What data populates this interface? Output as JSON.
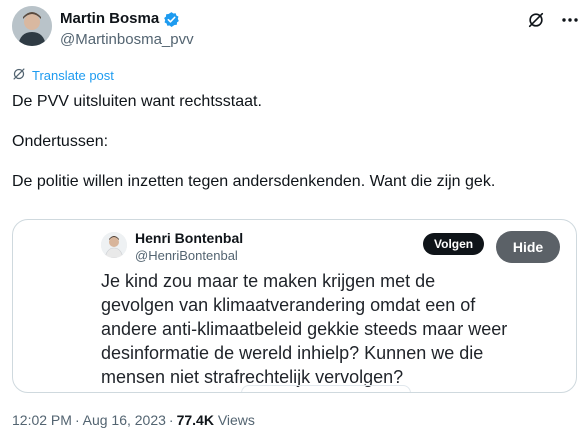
{
  "author": {
    "name": "Martin Bosma",
    "handle": "@Martinbosma_pvv"
  },
  "translate": {
    "label": "Translate post"
  },
  "post": {
    "lines": [
      "De PVV uitsluiten want rechtsstaat.",
      "Ondertussen:",
      "De politie willen inzetten tegen andersdenkenden. Want die zijn gek."
    ]
  },
  "quote": {
    "name": "Henri Bontenbal",
    "handle": "@HenriBontenbal",
    "follow_label": "Volgen",
    "text": "Je kind zou maar te maken krijgen met de gevolgen van klimaatverandering omdat een of andere anti-klimaatbeleid gekkie steeds maar weer desinformatie de wereld inhielp? Kunnen we die mensen niet strafrechtelijk vervolgen?",
    "hide_label": "Hide"
  },
  "meta": {
    "time": "12:02 PM",
    "date": "Aug 16, 2023",
    "views_count": "77.4K",
    "views_label": "Views"
  },
  "colors": {
    "accent": "#1d9bf0",
    "text": "#0f1419",
    "muted": "#536471"
  },
  "icons": [
    "verified-badge-icon",
    "no-translate-icon",
    "more-icon",
    "translate-icon"
  ]
}
